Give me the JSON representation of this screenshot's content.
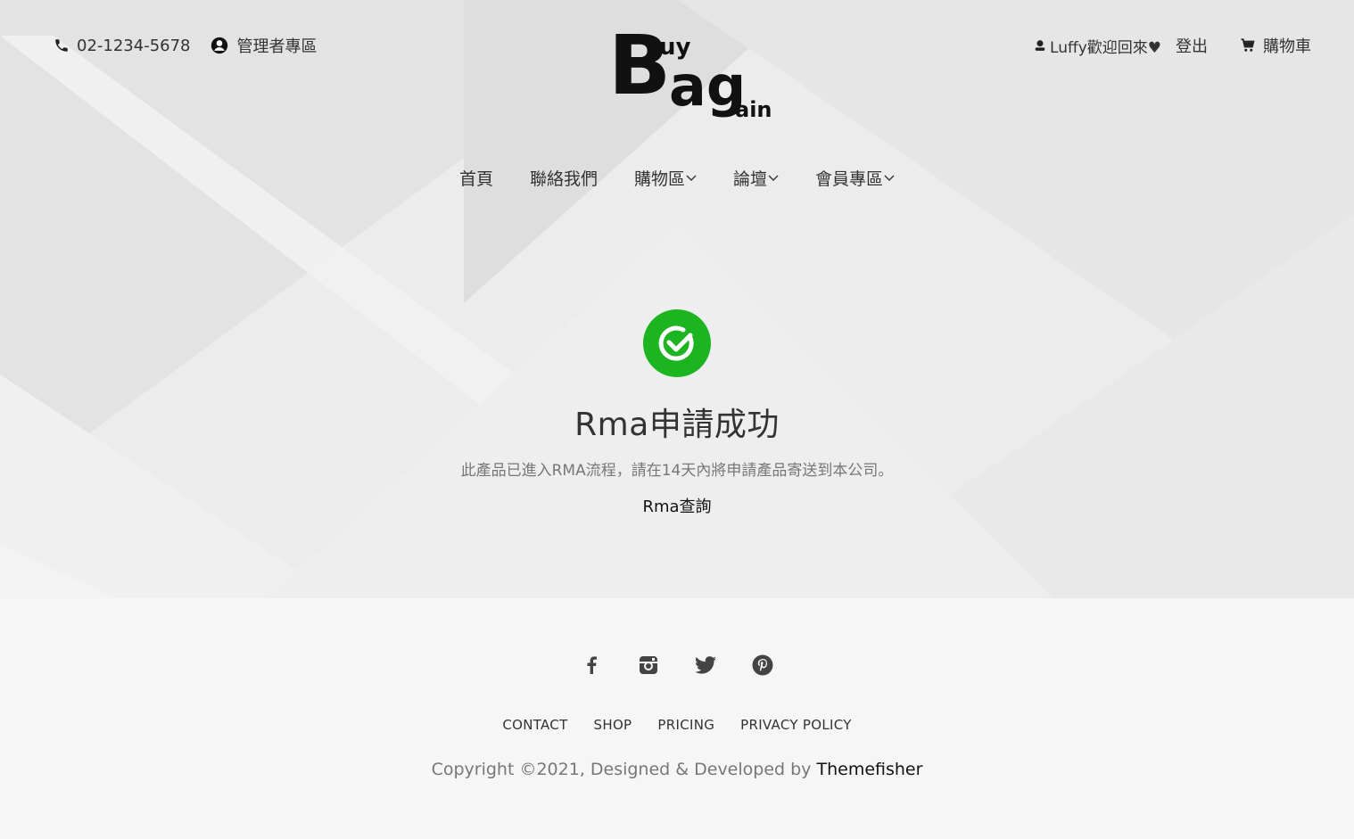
{
  "topbar": {
    "phone": "02-1234-5678",
    "admin_label": "管理者專區",
    "welcome": "Luffy歡迎回來♥",
    "logout": "登出",
    "cart": "購物車"
  },
  "logo": {
    "b": "B",
    "uy": "uy",
    "ag": "ag",
    "ain": "ain"
  },
  "nav": {
    "items": [
      {
        "label": "首頁"
      },
      {
        "label": "聯絡我們"
      },
      {
        "label": "購物區"
      },
      {
        "label": "論壇"
      },
      {
        "label": "會員專區"
      }
    ]
  },
  "success": {
    "title": "Rma申請成功",
    "description": "此產品已進入RMA流程，請在14天內將申請產品寄送到本公司。",
    "link": "Rma查詢",
    "icon": "check-circle-icon",
    "color": "#1db422"
  },
  "footer": {
    "social": [
      "facebook-icon",
      "instagram-icon",
      "twitter-icon",
      "pinterest-icon"
    ],
    "links": [
      "CONTACT",
      "SHOP",
      "PRICING",
      "PRIVACY POLICY"
    ],
    "copyright_prefix": "Copyright ©2021, Designed & Developed by ",
    "copyright_brand": "Themefisher"
  }
}
